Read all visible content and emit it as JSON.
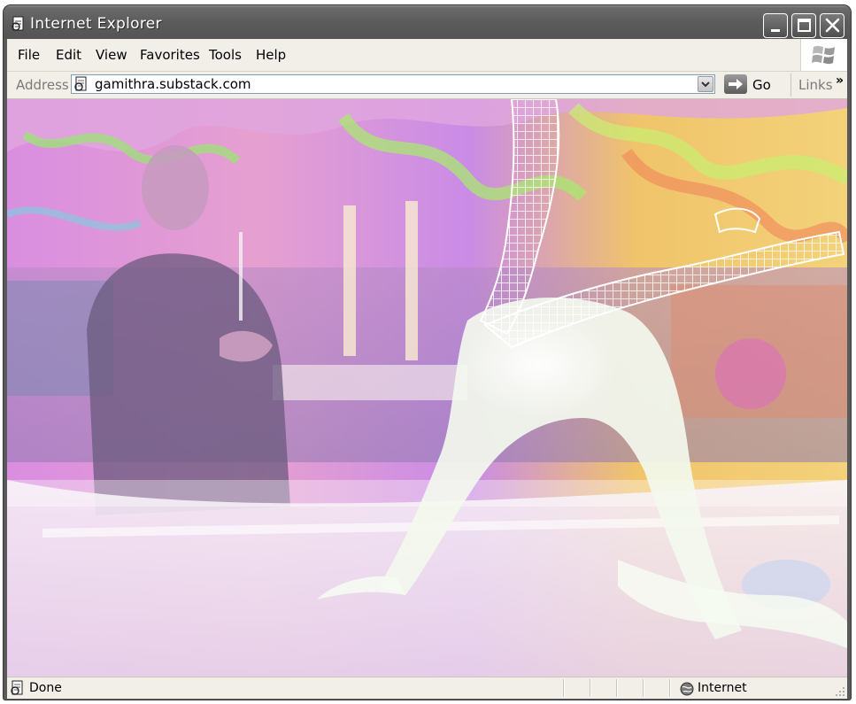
{
  "window": {
    "title": "Internet Explorer"
  },
  "menubar": {
    "items": [
      {
        "label": "File"
      },
      {
        "label": "Edit"
      },
      {
        "label": "View"
      },
      {
        "label": "Favorites"
      },
      {
        "label": "Tools"
      },
      {
        "label": "Help"
      }
    ]
  },
  "addressbar": {
    "label": "Address",
    "url": "gamithra.substack.com",
    "go_label": "Go",
    "links_label": "Links",
    "links_chevron": "»"
  },
  "statusbar": {
    "status": "Done",
    "zone": "Internet"
  },
  "icons": {
    "page": "ie-page-icon",
    "go": "go-arrow-icon",
    "zone": "globe-icon",
    "logo": "windows-flag-icon"
  },
  "colors": {
    "titlebar": "#5c5c5c",
    "chrome": "#f1efe8"
  }
}
